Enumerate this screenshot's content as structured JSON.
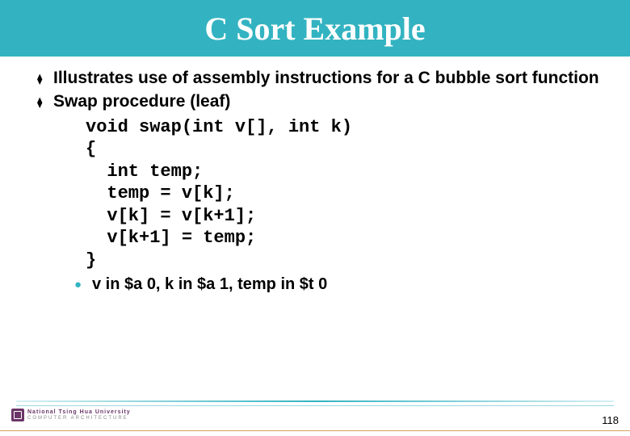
{
  "title": "C Sort Example",
  "bullets": [
    "Illustrates use of assembly instructions for a C bubble sort function",
    "Swap procedure (leaf)"
  ],
  "code": "void swap(int v[], int k)\n{\n  int temp;\n  temp = v[k];\n  v[k] = v[k+1];\n  v[k+1] = temp;\n}",
  "sub_bullet": "v in $a 0, k in $a 1, temp in $t 0",
  "footer": {
    "logo_line1": "National Tsing Hua University",
    "logo_line2": "COMPUTER ARCHITECTURE"
  },
  "page_number": "118"
}
